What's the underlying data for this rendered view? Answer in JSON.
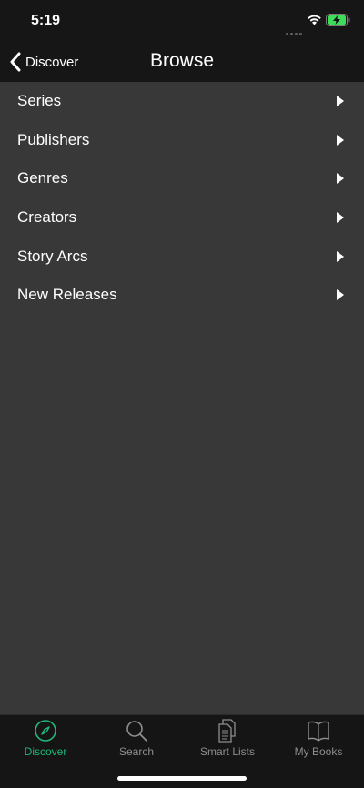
{
  "status_bar": {
    "time": "5:19"
  },
  "nav": {
    "back_label": "Discover",
    "title": "Browse"
  },
  "browse": {
    "items": [
      {
        "label": "Series"
      },
      {
        "label": "Publishers"
      },
      {
        "label": "Genres"
      },
      {
        "label": "Creators"
      },
      {
        "label": "Story Arcs"
      },
      {
        "label": "New Releases"
      }
    ]
  },
  "tabs": [
    {
      "label": "Discover",
      "icon": "compass-icon",
      "active": true
    },
    {
      "label": "Search",
      "icon": "magnifier-icon",
      "active": false
    },
    {
      "label": "Smart Lists",
      "icon": "documents-icon",
      "active": false
    },
    {
      "label": "My Books",
      "icon": "open-book-icon",
      "active": false
    }
  ],
  "colors": {
    "accent": "#1fb87a",
    "background": "#383838",
    "bar_background": "#161616",
    "tab_inactive": "#8e8e8e"
  }
}
